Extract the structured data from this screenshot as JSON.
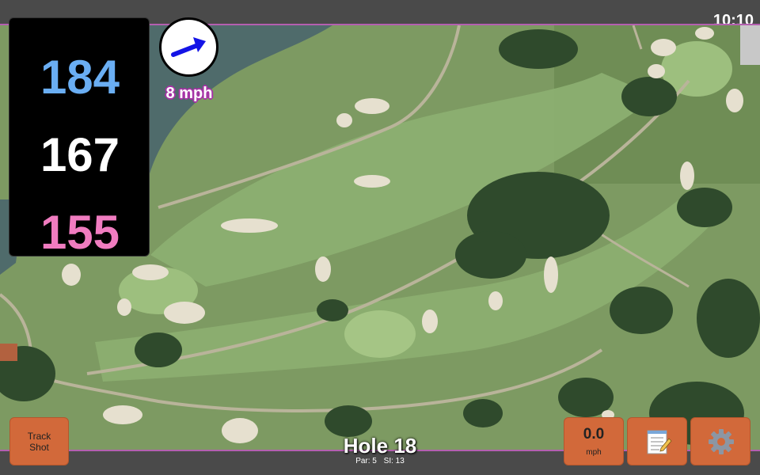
{
  "status": {
    "time": "10:10"
  },
  "distances": {
    "back": "184",
    "middle": "167",
    "front": "155"
  },
  "wind": {
    "speed_label": "8 mph",
    "direction_icon": "arrow-icon",
    "arrow_color": "#1414e6"
  },
  "hole": {
    "title": "Hole 18",
    "par_label": "Par: 5",
    "si_label": "SI: 13"
  },
  "buttons": {
    "track_shot_line1": "Track",
    "track_shot_line2": "Shot",
    "wind_value": "0.0",
    "wind_unit": "mph",
    "notes_icon": "notepad-icon",
    "settings_icon": "gear-icon"
  },
  "colors": {
    "distance_back": "#6aaef3",
    "distance_middle": "#ffffff",
    "distance_front": "#f07cc0",
    "button": "#d2693a",
    "accent": "#b45fb0"
  }
}
